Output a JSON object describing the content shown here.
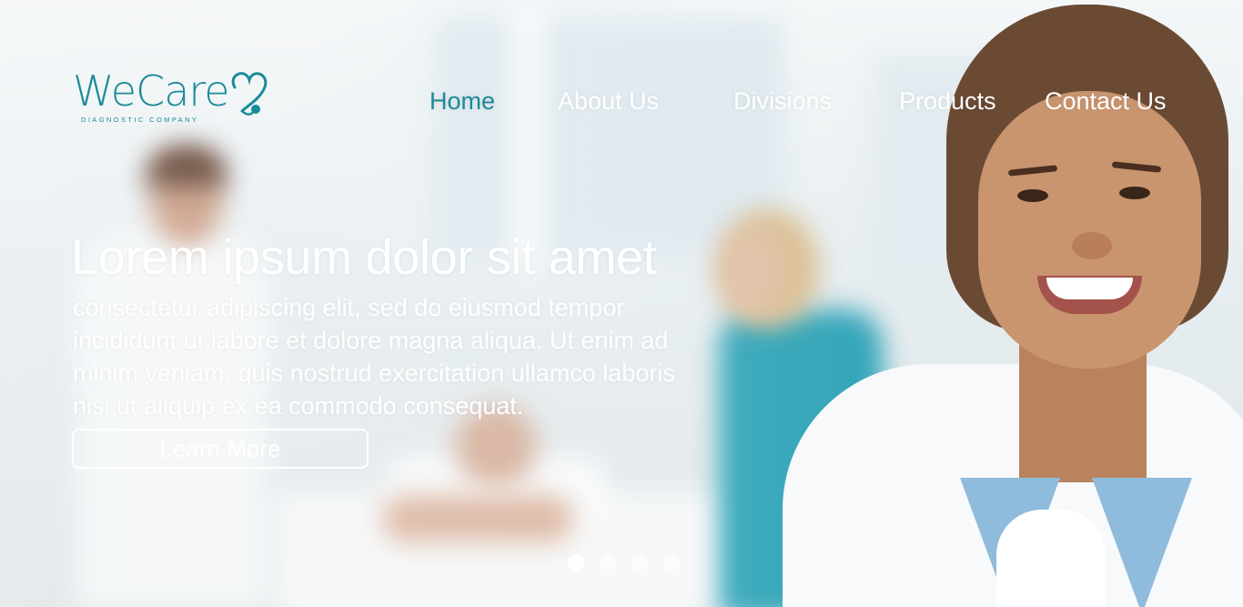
{
  "brand": {
    "name": "WeCare",
    "tagline": "DIAGNOSTIC COMPANY",
    "accent_color": "#1a8b98"
  },
  "nav": {
    "items": [
      {
        "label": "Home",
        "active": true
      },
      {
        "label": "About Us",
        "active": false
      },
      {
        "label": "Divisions",
        "active": false
      },
      {
        "label": "Products",
        "active": false
      },
      {
        "label": "Contact Us",
        "active": false
      }
    ]
  },
  "hero": {
    "title": "Lorem ipsum dolor sit amet",
    "body": "consectetur adipiscing elit, sed do eiusmod tempor incididunt ut labore et dolore magna aliqua. Ut enim ad minim veniam, quis nostrud exercitation ullamco laboris nisi ut aliquip ex ea commodo consequat.",
    "cta_label": "Learn More"
  },
  "carousel": {
    "slide_count": 4,
    "active_index": 0
  },
  "icons": {
    "logo_mark": "heart-stethoscope-icon"
  }
}
